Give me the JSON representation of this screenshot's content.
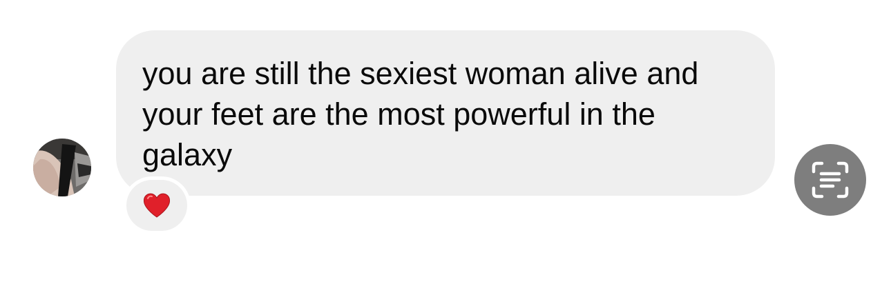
{
  "message": {
    "text": "you are still the sexiest woman alive and your feet are the most powerful in the galaxy",
    "bubble_color": "#efefef",
    "text_color": "#0a0a0a"
  },
  "reaction": {
    "emoji_name": "red-heart",
    "color": "#e0202a"
  },
  "sender": {
    "avatar": "profile-photo"
  },
  "actions": {
    "scan_icon": "live-text-scan-icon",
    "button_color": "#7e7e7e"
  }
}
